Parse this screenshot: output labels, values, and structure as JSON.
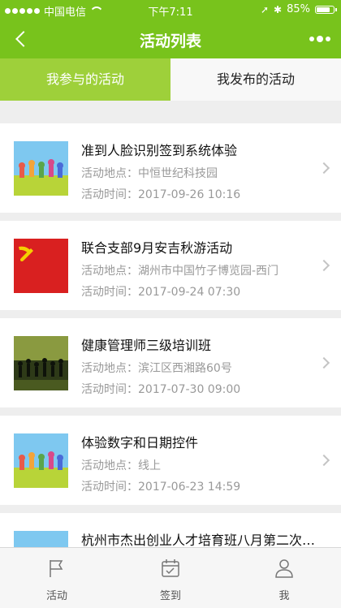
{
  "status_bar": {
    "carrier": "中国电信",
    "time": "下午7:11",
    "battery": "85%"
  },
  "navbar": {
    "title": "活动列表"
  },
  "tabs": [
    {
      "label": "我参与的活动",
      "active": true
    },
    {
      "label": "我发布的活动",
      "active": false
    }
  ],
  "activities": [
    {
      "title": "准到人脸识别签到系统体验",
      "location": "活动地点：中恒世纪科技园",
      "time": "活动时间：2017-09-26 10:16",
      "thumb": "group-photo"
    },
    {
      "title": "联合支部9月安吉秋游活动",
      "location": "活动地点：湖州市中国竹子博览园-西门",
      "time": "活动时间：2017-09-24 07:30",
      "thumb": "party-flag"
    },
    {
      "title": "健康管理师三级培训班",
      "location": "活动地点：滨江区西湘路60号",
      "time": "活动时间：2017-07-30 09:00",
      "thumb": "silhouette-photo"
    },
    {
      "title": "体验数字和日期控件",
      "location": "活动地点：线上",
      "time": "活动时间：2017-06-23 14:59",
      "thumb": "group-photo"
    },
    {
      "title": "杭州市杰出创业人才培育班八月第二次…",
      "location": "",
      "time": "",
      "thumb": "group-photo"
    }
  ],
  "tabbar": [
    {
      "label": "活动",
      "icon": "flag-icon"
    },
    {
      "label": "签到",
      "icon": "calendar-check-icon"
    },
    {
      "label": "我",
      "icon": "person-icon"
    }
  ],
  "colors": {
    "header_green": "#78c31c",
    "active_tab_green": "#9ed03a"
  }
}
